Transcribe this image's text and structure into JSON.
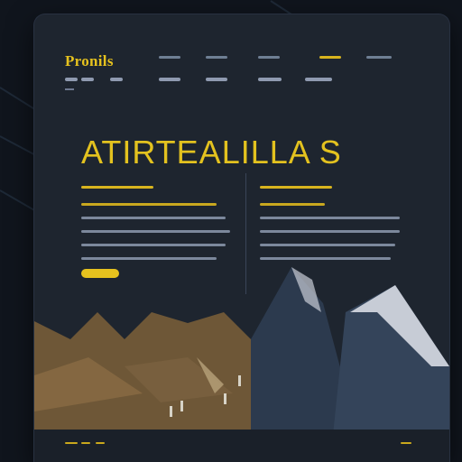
{
  "site": {
    "logo": "Pronils",
    "hero_title": "ATIRTEALILLA S"
  },
  "nav": {
    "primary_links": [
      {
        "label": ""
      },
      {
        "label": ""
      },
      {
        "label": ""
      },
      {
        "label": ""
      },
      {
        "label": ""
      }
    ],
    "secondary_links": [
      {
        "label": ""
      },
      {
        "label": ""
      },
      {
        "label": ""
      },
      {
        "label": ""
      },
      {
        "label": ""
      },
      {
        "label": ""
      },
      {
        "label": ""
      }
    ]
  },
  "cta": {
    "label": ""
  },
  "footer": {
    "links": [
      {
        "label": ""
      },
      {
        "label": ""
      },
      {
        "label": ""
      },
      {
        "label": ""
      }
    ]
  },
  "colors": {
    "accent": "#e6c21e",
    "panel": "#1e252f",
    "background": "#10151d",
    "mountain_snow": "#c7ccd6",
    "mountain_dark": "#2c3a4e",
    "mountain_brown": "#6e5737"
  },
  "icons": [
    "mountain-illustration"
  ]
}
